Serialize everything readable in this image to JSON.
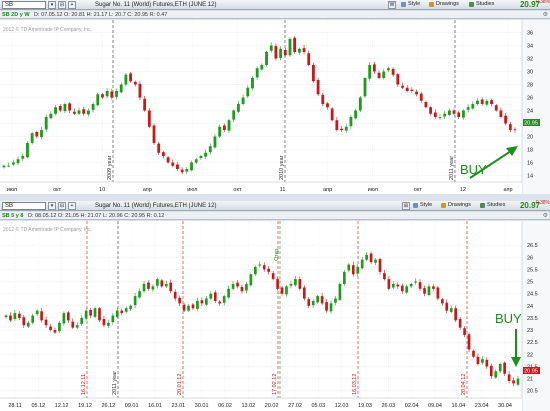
{
  "colors": {
    "up": "#1f9a1f",
    "down": "#c41a1a",
    "grid": "#d8d8d8",
    "accent": "#1a8a1a"
  },
  "top_window": {
    "symbol": "SB",
    "description": "Sugar No. 11 (World) Futures,ETH (JUNE 12)",
    "price": "20.97",
    "change_pct": "-0.38%",
    "buttons": [
      {
        "label": "Style",
        "icon": "style-icon"
      },
      {
        "label": "Drawings",
        "icon": "pencil-icon"
      },
      {
        "label": "Studies",
        "icon": "studies-icon"
      }
    ],
    "aggregation": "SB 2D y W",
    "ohlc": "D: 07.05.12   O: 20.81   H: 21.17   L: 20.7   C: 20.95   R: 0.47",
    "copyright": "2012 © TD Ameritrade IP Company, Inc.",
    "price_labels": [
      "36",
      "34",
      "32",
      "30",
      "28",
      "26",
      "24",
      "22",
      "20",
      "18",
      "16",
      "14"
    ],
    "last_price_tag": "20.95",
    "x_labels": [
      "июл",
      "окт",
      "10",
      "апр",
      "июл",
      "окт",
      "11",
      "апр",
      "июл",
      "окт",
      "12",
      "апр"
    ],
    "year_markers": [
      "2009 year",
      "2010 year",
      "2011 year"
    ],
    "annotation": "BUY"
  },
  "bottom_window": {
    "symbol": "SB",
    "description": "Sugar No. 11 (World) Futures,ETH (JUNE 12)",
    "price": "20.97",
    "change_pct": "-0.38%",
    "buttons": [
      {
        "label": "Style",
        "icon": "style-icon"
      },
      {
        "label": "Drawings",
        "icon": "pencil-icon"
      },
      {
        "label": "Studies",
        "icon": "studies-icon"
      }
    ],
    "aggregation": "SB 5 y 8",
    "ohlc": "D: 08.05.12   O: 21.05   H: 21.07   L: 20.96   C: 20.95   R: 0.12",
    "copyright": "2012 © TD Ameritrade IP Company, Inc.",
    "price_labels": [
      "26.5",
      "26",
      "25.5",
      "25",
      "24.5",
      "24",
      "23.5",
      "23",
      "22.5",
      "22",
      "21.5",
      "21",
      "20.5"
    ],
    "last_price_tag": "20.95",
    "x_labels": [
      "28.11",
      "05.12",
      "12.12",
      "19.12",
      "26.12",
      "09.01",
      "16.01",
      "23.01",
      "30.01",
      "06.02",
      "13.02",
      "20.02",
      "27.02",
      "05.03",
      "12.03",
      "19.03",
      "26.03",
      "02.04",
      "09.04",
      "16.04",
      "23.04",
      "30.04"
    ],
    "red_markers": [
      "16.12.11",
      "20.01.12",
      "17.02.12",
      "16.03.12",
      "20.04.12"
    ],
    "green_marker": "Откр",
    "year_marker": "2011 year",
    "annotation": "BUY"
  },
  "chart_data": [
    {
      "type": "candlestick",
      "title": "Sugar No. 11 (World) Futures,ETH (JUNE 12) — 2D",
      "ylim": [
        13,
        37
      ],
      "x": [
        "июл",
        "окт",
        "10",
        "апр",
        "июл",
        "окт",
        "11",
        "апр",
        "июл",
        "окт",
        "12",
        "апр"
      ],
      "closes": [
        15.5,
        15.5,
        16,
        16.5,
        17,
        19,
        20.5,
        20,
        21,
        23,
        23.5,
        24.5,
        24,
        25,
        24,
        23.5,
        24,
        23.5,
        24,
        25,
        26.5,
        26,
        27,
        26,
        27,
        28,
        29.5,
        28.5,
        28,
        26,
        24,
        21.5,
        19,
        17.5,
        17,
        16,
        15.5,
        15,
        14.5,
        15,
        16,
        16.5,
        17,
        17.5,
        18.5,
        20,
        21.5,
        21,
        22.5,
        24,
        25,
        26,
        27.5,
        29,
        30.5,
        31,
        33,
        34,
        32,
        33.5,
        32.5,
        35,
        33,
        33.5,
        33,
        31,
        28.5,
        26.5,
        25,
        24.5,
        22.5,
        21,
        21,
        21.5,
        23,
        24,
        26,
        29,
        31,
        30,
        29,
        30,
        30.5,
        29.5,
        28,
        27.5,
        27,
        27,
        26.5,
        25.5,
        24.5,
        23.5,
        23,
        23,
        23.5,
        24,
        23.5,
        23,
        24,
        24.5,
        25,
        25.5,
        25,
        25.5,
        25,
        24,
        23,
        22,
        21,
        21
      ]
    },
    {
      "type": "candlestick",
      "title": "Sugar No. 11 (World) Futures,ETH (JUNE 12) — daily",
      "ylim": [
        20.2,
        27
      ],
      "x": [
        "28.11",
        "05.12",
        "12.12",
        "19.12",
        "26.12",
        "09.01",
        "16.01",
        "23.01",
        "30.01",
        "06.02",
        "13.02",
        "20.02",
        "27.02",
        "05.03",
        "12.03",
        "19.03",
        "26.03",
        "02.04",
        "09.04",
        "16.04",
        "23.04",
        "30.04"
      ],
      "closes": [
        23.6,
        23.4,
        23.7,
        23.5,
        23.2,
        23.3,
        23.6,
        23.8,
        23.4,
        23.2,
        23,
        22.9,
        23.3,
        23.7,
        23.4,
        23.1,
        23.2,
        23.5,
        23.8,
        23.6,
        23.9,
        23.4,
        23.2,
        23.3,
        23.6,
        23.8,
        23.7,
        23.9,
        24,
        24.4,
        24.6,
        24.9,
        24.7,
        24.8,
        25.1,
        24.8,
        24.9,
        24.6,
        24.3,
        24.1,
        23.8,
        24,
        23.9,
        24.2,
        24.1,
        24.3,
        24.5,
        24.2,
        24.1,
        24.4,
        24.7,
        24.9,
        24.8,
        24.6,
        24.9,
        25.3,
        25.6,
        25.7,
        25.5,
        25.4,
        25.1,
        24.7,
        24.5,
        24.8,
        24.9,
        25.1,
        24.7,
        24.3,
        24,
        24.2,
        24.4,
        24.1,
        23.8,
        24.1,
        24.3,
        24.9,
        25.4,
        25.7,
        25.3,
        25.6,
        25.9,
        26.1,
        25.8,
        25.9,
        25.4,
        25.1,
        24.7,
        24.9,
        24.8,
        24.6,
        24.8,
        24.9,
        25,
        24.7,
        24.5,
        24.8,
        24.7,
        24.3,
        24.1,
        23.8,
        23.9,
        23.4,
        23.1,
        22.8,
        22.2,
        21.9,
        21.6,
        21.8,
        21.5,
        21.1,
        21.3,
        21.6,
        21.2,
        20.9,
        20.8,
        21
      ]
    }
  ]
}
